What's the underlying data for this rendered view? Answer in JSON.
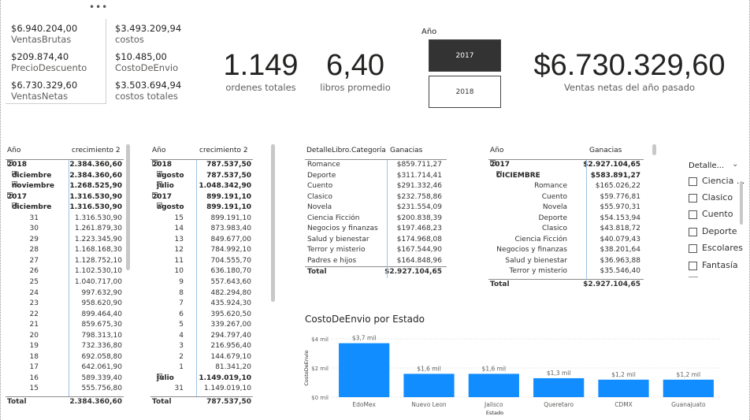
{
  "more_menu": "•••",
  "multicard_left": [
    {
      "value": "$6.940.204,00",
      "label": "VentasBrutas"
    },
    {
      "value": "$209.874,40",
      "label": "PrecioDescuento"
    },
    {
      "value": "$6.730.329,60",
      "label": "VentasNetas"
    }
  ],
  "multicard_right": [
    {
      "value": "$3.493.209,94",
      "label": "costos"
    },
    {
      "value": "$10.485,00",
      "label": "CostoDeEnvio"
    },
    {
      "value": "$3.503.694,94",
      "label": "costos totales"
    }
  ],
  "kpis": {
    "orders": {
      "value": "1.149",
      "label": "ordenes totales"
    },
    "books": {
      "value": "6,40",
      "label": "libros promedio"
    },
    "last_year": {
      "value": "$6.730.329,60",
      "label": "Ventas netas del año pasado"
    }
  },
  "year_slicer": {
    "title": "Año",
    "options": [
      "2017",
      "2018"
    ],
    "selected": "2017"
  },
  "matrix1": {
    "headers": [
      "Año",
      "crecimiento 2"
    ],
    "rows": [
      {
        "label": "2018",
        "value": "2.384.360,60",
        "level": 0,
        "bold": true,
        "exp": "⊟"
      },
      {
        "label": "diciembre",
        "value": "2.384.360,60",
        "level": 1,
        "bold": true,
        "exp": "⊞"
      },
      {
        "label": "noviembre",
        "value": "1.268.525,90",
        "level": 1,
        "bold": true,
        "exp": "⊞"
      },
      {
        "label": "2017",
        "value": "1.316.530,90",
        "level": 0,
        "bold": true,
        "exp": "⊟"
      },
      {
        "label": "diciembre",
        "value": "1.316.530,90",
        "level": 1,
        "bold": true,
        "exp": "⊟"
      },
      {
        "label": "31",
        "value": "1.316.530,90",
        "level": 2
      },
      {
        "label": "30",
        "value": "1.261.879,30",
        "level": 2
      },
      {
        "label": "29",
        "value": "1.223.345,90",
        "level": 2
      },
      {
        "label": "28",
        "value": "1.168.168,30",
        "level": 2
      },
      {
        "label": "27",
        "value": "1.128.752,10",
        "level": 2
      },
      {
        "label": "26",
        "value": "1.102.530,10",
        "level": 2
      },
      {
        "label": "25",
        "value": "1.040.717,00",
        "level": 2
      },
      {
        "label": "24",
        "value": "997.632,90",
        "level": 2
      },
      {
        "label": "23",
        "value": "958.620,90",
        "level": 2
      },
      {
        "label": "22",
        "value": "899.464,40",
        "level": 2
      },
      {
        "label": "21",
        "value": "859.675,30",
        "level": 2
      },
      {
        "label": "20",
        "value": "798.313,10",
        "level": 2
      },
      {
        "label": "19",
        "value": "732.336,80",
        "level": 2
      },
      {
        "label": "18",
        "value": "692.058,80",
        "level": 2
      },
      {
        "label": "17",
        "value": "642.061,90",
        "level": 2
      },
      {
        "label": "16",
        "value": "589.339,40",
        "level": 2
      },
      {
        "label": "15",
        "value": "555.756,80",
        "level": 2
      }
    ],
    "total": {
      "label": "Total",
      "value": "2.384.360,60"
    }
  },
  "matrix2": {
    "headers": [
      "Año",
      "crecimiento 2"
    ],
    "rows": [
      {
        "label": "2018",
        "value": "787.537,50",
        "level": 0,
        "bold": true,
        "exp": "⊟"
      },
      {
        "label": "agosto",
        "value": "787.537,50",
        "level": 1,
        "bold": true,
        "exp": "⊞"
      },
      {
        "label": "julio",
        "value": "1.048.342,90",
        "level": 1,
        "bold": true,
        "exp": "⊞"
      },
      {
        "label": "2017",
        "value": "899.191,10",
        "level": 0,
        "bold": true,
        "exp": "⊟"
      },
      {
        "label": "agosto",
        "value": "899.191,10",
        "level": 1,
        "bold": true,
        "exp": "⊟"
      },
      {
        "label": "15",
        "value": "899.191,10",
        "level": 2
      },
      {
        "label": "14",
        "value": "873.983,40",
        "level": 2
      },
      {
        "label": "13",
        "value": "849.677,00",
        "level": 2
      },
      {
        "label": "12",
        "value": "784.992,10",
        "level": 2
      },
      {
        "label": "11",
        "value": "704.555,70",
        "level": 2
      },
      {
        "label": "10",
        "value": "636.180,70",
        "level": 2
      },
      {
        "label": "9",
        "value": "557.643,60",
        "level": 2
      },
      {
        "label": "8",
        "value": "482.294,80",
        "level": 2
      },
      {
        "label": "7",
        "value": "435.924,30",
        "level": 2
      },
      {
        "label": "6",
        "value": "395.620,50",
        "level": 2
      },
      {
        "label": "5",
        "value": "339.267,00",
        "level": 2
      },
      {
        "label": "4",
        "value": "294.797,40",
        "level": 2
      },
      {
        "label": "3",
        "value": "216.956,40",
        "level": 2
      },
      {
        "label": "2",
        "value": "144.679,10",
        "level": 2
      },
      {
        "label": "1",
        "value": "81.341,20",
        "level": 2
      },
      {
        "label": "julio",
        "value": "1.149.019,10",
        "level": 1,
        "bold": true,
        "exp": "⊟"
      },
      {
        "label": "31",
        "value": "1.149.019,10",
        "level": 2
      }
    ],
    "total": {
      "label": "Total",
      "value": "787.537,50"
    }
  },
  "cat_table": {
    "headers": [
      "DetalleLibro.Categoría",
      "Ganacias"
    ],
    "rows": [
      {
        "label": "Romance",
        "value": "$859.711,27"
      },
      {
        "label": "Deporte",
        "value": "$311.714,41"
      },
      {
        "label": "Cuento",
        "value": "$291.332,46"
      },
      {
        "label": "Clasico",
        "value": "$232.758,86"
      },
      {
        "label": "Novela",
        "value": "$231.554,09"
      },
      {
        "label": "Ciencia Ficción",
        "value": "$200.838,39"
      },
      {
        "label": "Negocios y finanzas",
        "value": "$197.468,23"
      },
      {
        "label": "Salud y bienestar",
        "value": "$174.968,08"
      },
      {
        "label": "Terror y misterio",
        "value": "$167.544,90"
      },
      {
        "label": "Padres e hijos",
        "value": "$164.848,96"
      }
    ],
    "total": {
      "label": "Total",
      "value": "$2.927.104,65"
    }
  },
  "year_matrix": {
    "headers": [
      "Año",
      "Ganacias"
    ],
    "rows": [
      {
        "label": "2017",
        "value": "$2.927.104,65",
        "level": 0,
        "bold": true,
        "exp": "⊟"
      },
      {
        "label": "DICIEMBRE",
        "value": "$583.891,27",
        "level": 1,
        "bold": true,
        "exp": "⊟"
      },
      {
        "label": "Romance",
        "value": "$165.026,22",
        "level": 2
      },
      {
        "label": "Cuento",
        "value": "$59.776,81",
        "level": 2
      },
      {
        "label": "Novela",
        "value": "$55.970,31",
        "level": 2
      },
      {
        "label": "Deporte",
        "value": "$54.153,94",
        "level": 2
      },
      {
        "label": "Clasico",
        "value": "$43.818,72",
        "level": 2
      },
      {
        "label": "Ciencia Ficción",
        "value": "$40.079,43",
        "level": 2
      },
      {
        "label": "Negocios y finanzas",
        "value": "$38.201,64",
        "level": 2
      },
      {
        "label": "Salud y bienestar",
        "value": "$36.963,88",
        "level": 2
      },
      {
        "label": "Terror y misterio",
        "value": "$35.546,40",
        "level": 2
      }
    ],
    "total": {
      "label": "Total",
      "value": "$2.927.104,65"
    }
  },
  "category_slicer": {
    "title": "Detalle...",
    "items": [
      "Ciencia ...",
      "Clasico",
      "Cuento",
      "Deporte",
      "Escolares",
      "Fantasía"
    ]
  },
  "chart_data": {
    "type": "bar",
    "title": "CostoDeEnvio por Estado",
    "xlabel": "Estado",
    "ylabel": "CostoDeEnvio",
    "categories": [
      "EdoMex",
      "Nuevo Leon",
      "Jalisco",
      "Queretaro",
      "CDMX",
      "Guanajuato"
    ],
    "values": [
      3700,
      1600,
      1600,
      1300,
      1200,
      1200
    ],
    "data_labels": [
      "$3,7 mil",
      "$1,6 mil",
      "$1,6 mil",
      "$1,3 mil",
      "$1,2 mil",
      "$1,2 mil"
    ],
    "yticks": [
      "$0 mil",
      "$2 mil",
      "$4 mil"
    ],
    "ytick_values": [
      0,
      2000,
      4000
    ],
    "ylim": [
      0,
      4000
    ],
    "color": "#118DFF"
  }
}
